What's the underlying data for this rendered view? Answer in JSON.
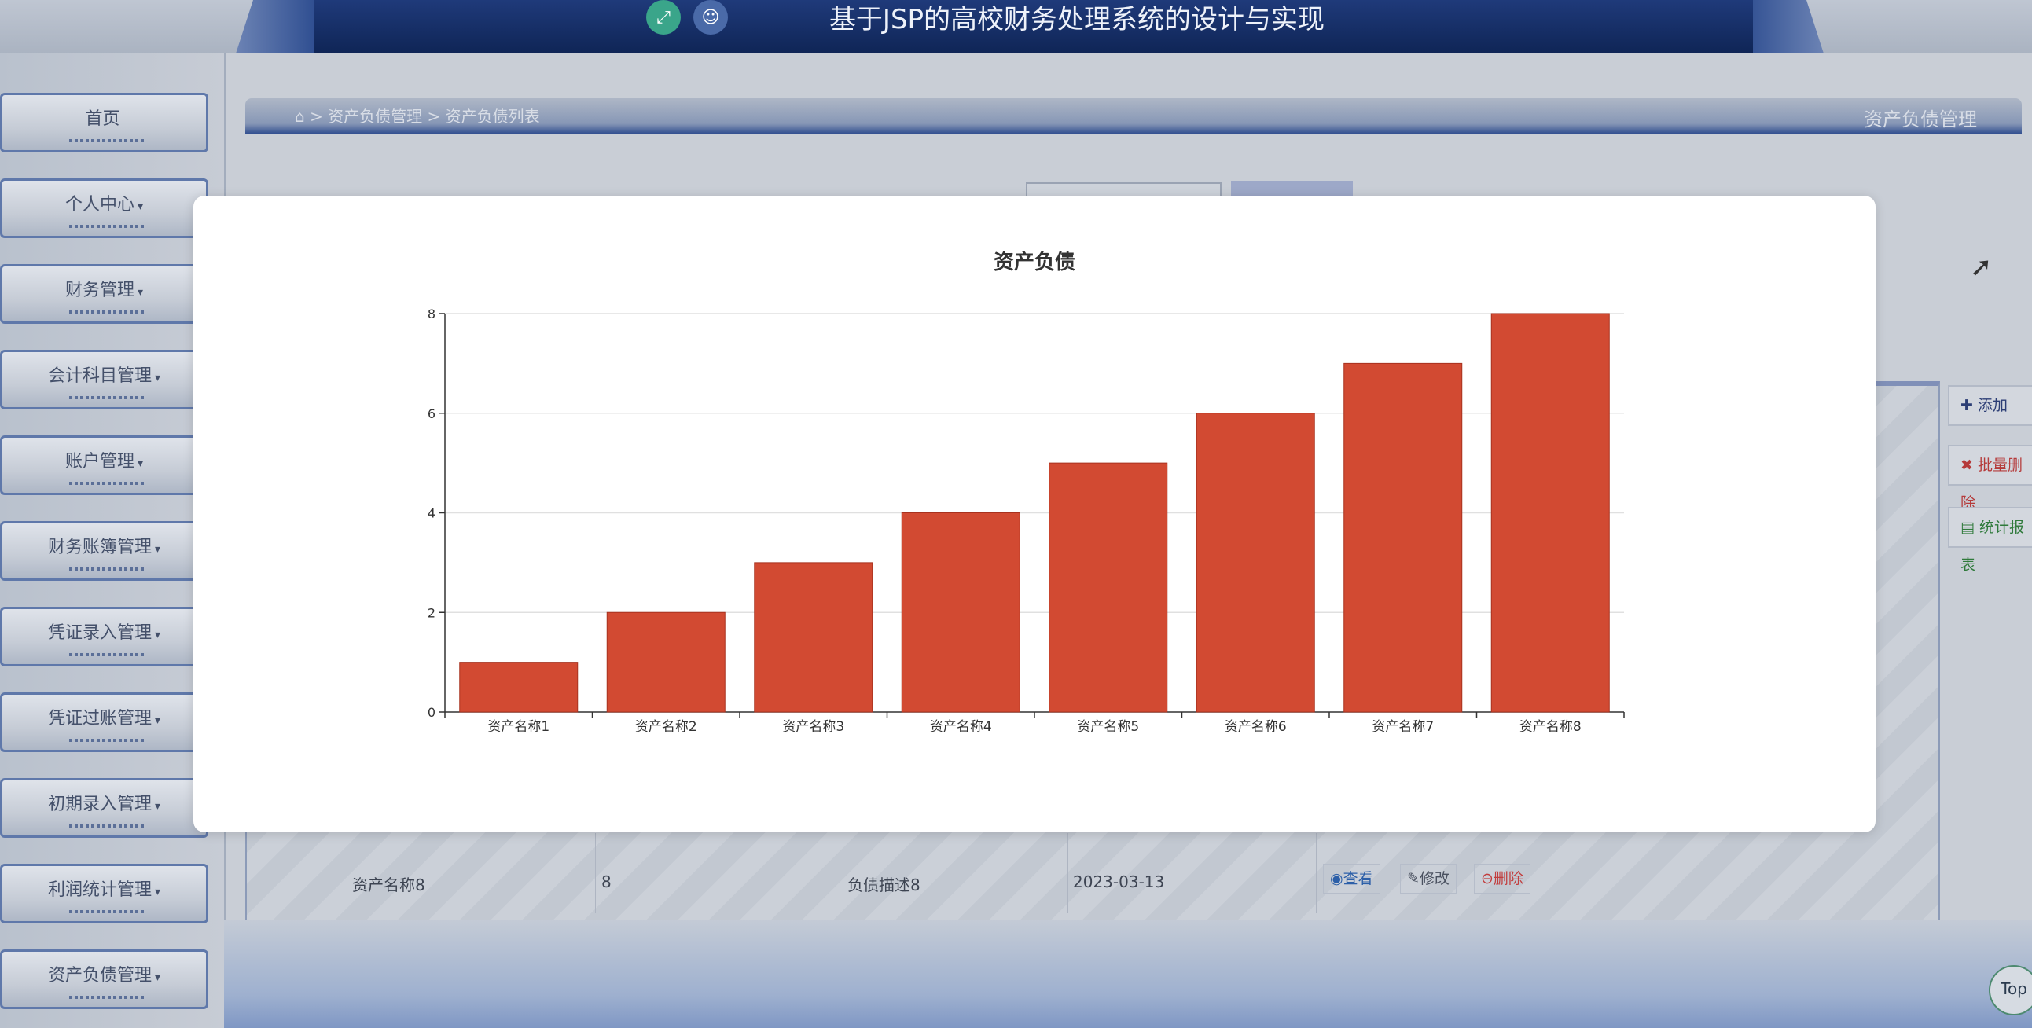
{
  "header": {
    "title": "基于JSP的高校财务处理系统的设计与实现",
    "icons": [
      "fullscreen-icon",
      "user-icon"
    ]
  },
  "sidebar": {
    "items": [
      {
        "label": "首页",
        "caret": ""
      },
      {
        "label": "个人中心",
        "caret": "▾"
      },
      {
        "label": "财务管理",
        "caret": "▾"
      },
      {
        "label": "会计科目管理",
        "caret": "▾"
      },
      {
        "label": "账户管理",
        "caret": "▾"
      },
      {
        "label": "财务账簿管理",
        "caret": "▾"
      },
      {
        "label": "凭证录入管理",
        "caret": "▾"
      },
      {
        "label": "凭证过账管理",
        "caret": "▾"
      },
      {
        "label": "初期录入管理",
        "caret": "▾"
      },
      {
        "label": "利润统计管理",
        "caret": "▾"
      },
      {
        "label": "资产负债管理",
        "caret": "▾"
      }
    ]
  },
  "breadcrumb": {
    "home_icon": "home-icon",
    "path": "> 资产负债管理 > 资产负债列表",
    "right_title": "资产负债管理"
  },
  "actions": {
    "add": "✚ 添加",
    "batch_delete": "✖ 批量删除",
    "stats": "▤ 统计报表"
  },
  "table": {
    "last_row": {
      "name": "资产名称8",
      "value": "8",
      "desc": "负债描述8",
      "date": "2023-03-13",
      "view": "◉查看",
      "edit": "✎修改",
      "delete": "⊖删除"
    }
  },
  "top_button": "Top",
  "colors": {
    "bar": "#d24a32",
    "header_bg": "#1f3a7a"
  },
  "chart_data": {
    "type": "bar",
    "title": "资产负债",
    "categories": [
      "资产名称1",
      "资产名称2",
      "资产名称3",
      "资产名称4",
      "资产名称5",
      "资产名称6",
      "资产名称7",
      "资产名称8"
    ],
    "values": [
      1,
      2,
      3,
      4,
      5,
      6,
      7,
      8
    ],
    "xlabel": "",
    "ylabel": "",
    "ylim": [
      0,
      8
    ],
    "yticks": [
      0,
      2,
      4,
      6,
      8
    ],
    "grid": true,
    "legend": "none"
  }
}
